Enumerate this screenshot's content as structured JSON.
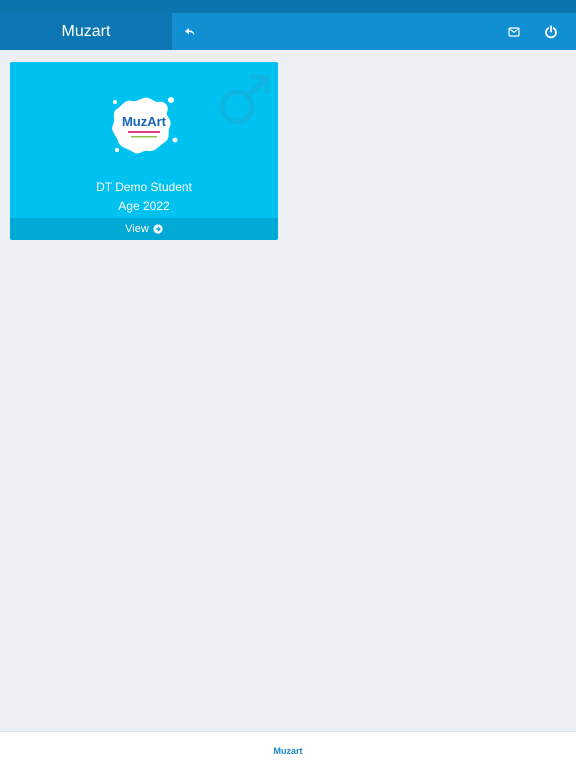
{
  "header": {
    "brand": "Muzart"
  },
  "student_card": {
    "logo_text": "MuzArt",
    "name": "DT Demo Student",
    "age_label": "Age 2022",
    "view_label": "View"
  },
  "footer": {
    "label": "Muzart"
  },
  "colors": {
    "header_primary": "#118fd3",
    "header_dark": "#0c76b3",
    "card_bg": "#00c2f0",
    "card_footer": "#00a9d6",
    "page_bg": "#eceff3",
    "footer_text": "#1c86c5"
  },
  "icons": {
    "back": "reply-arrow-icon",
    "mail": "envelope-icon",
    "power": "power-icon",
    "gender": "male-symbol-icon",
    "view_arrow": "circle-arrow-right-icon"
  }
}
